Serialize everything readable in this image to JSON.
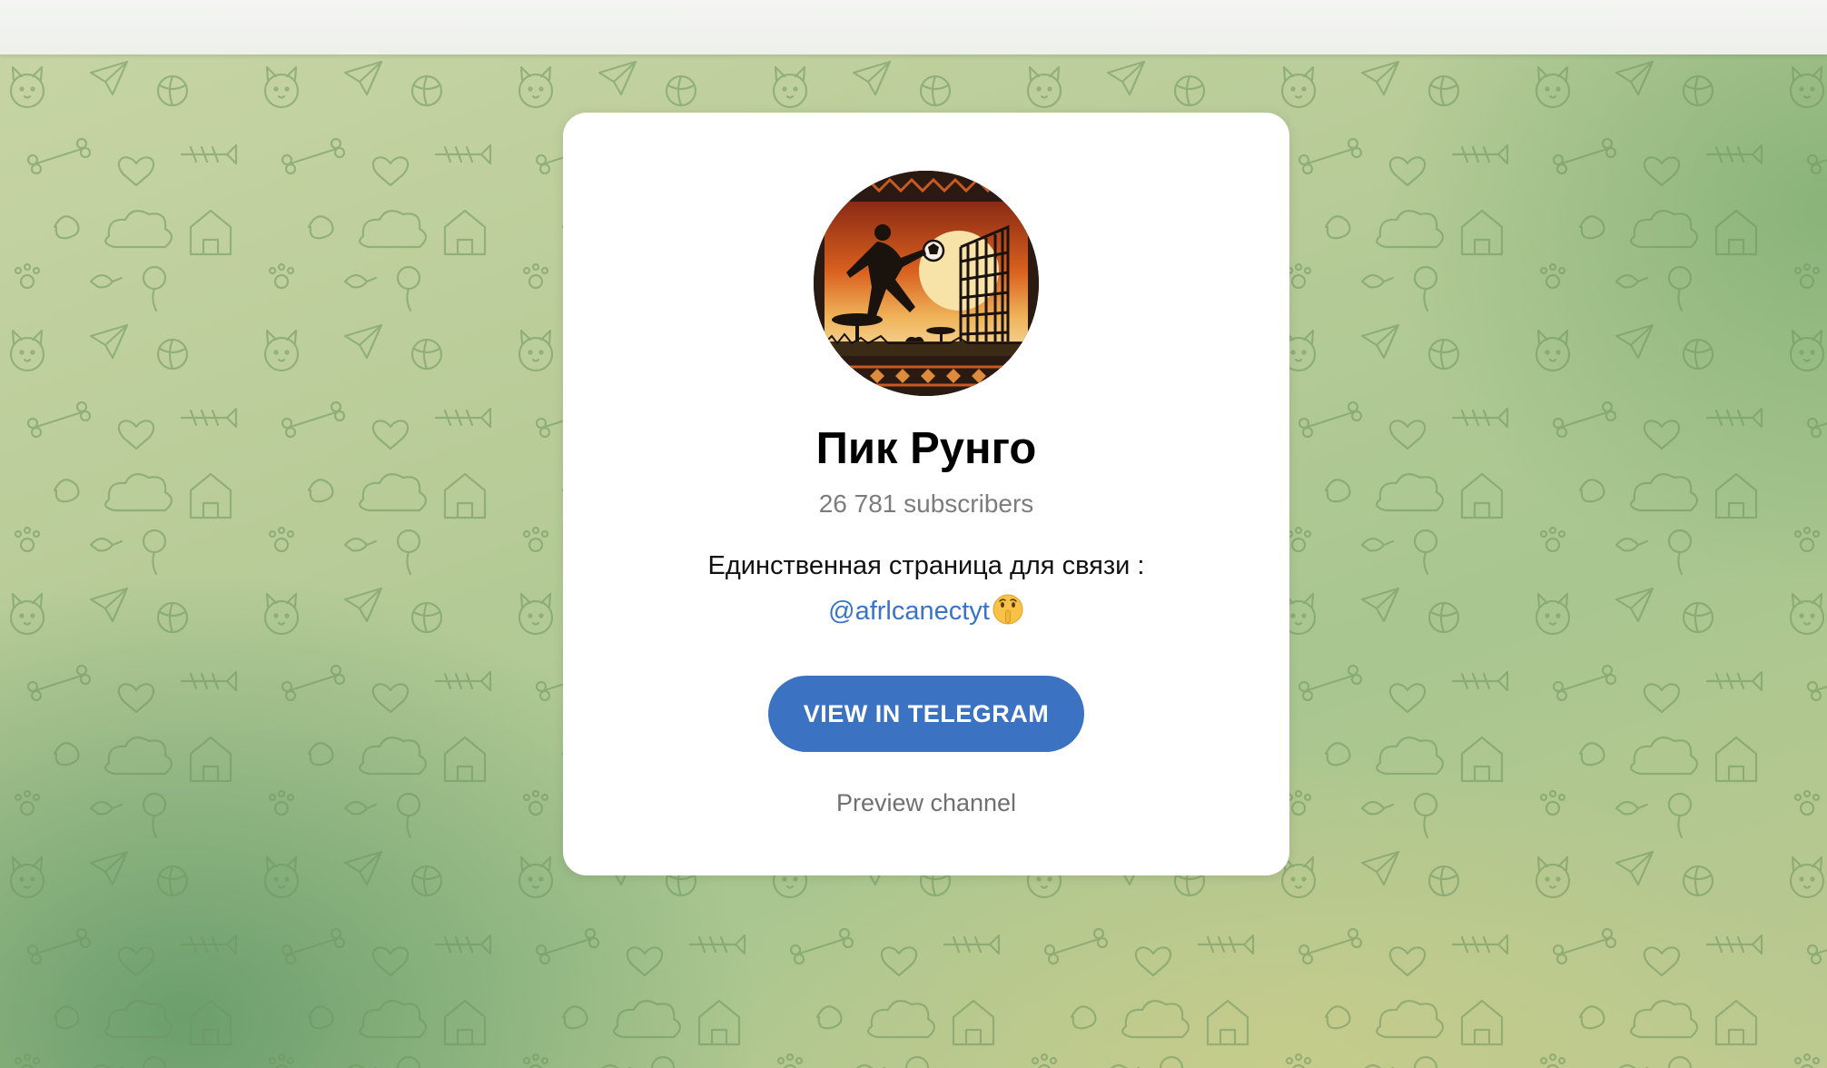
{
  "channel": {
    "title": "Пик Рунго",
    "subscribers": "26 781 subscribers",
    "description_line1": "Единственная страница для связи :",
    "mention": "@afrlcanectyt",
    "emoji": "shushing-face-emoji"
  },
  "actions": {
    "view_button_label": "VIEW IN TELEGRAM",
    "preview_label": "Preview channel"
  },
  "colors": {
    "button": "#3c72c2",
    "mention": "#3a74c9",
    "background_green": "#b8cc98"
  },
  "icons": {
    "avatar": "football-player-sunset-avatar"
  }
}
